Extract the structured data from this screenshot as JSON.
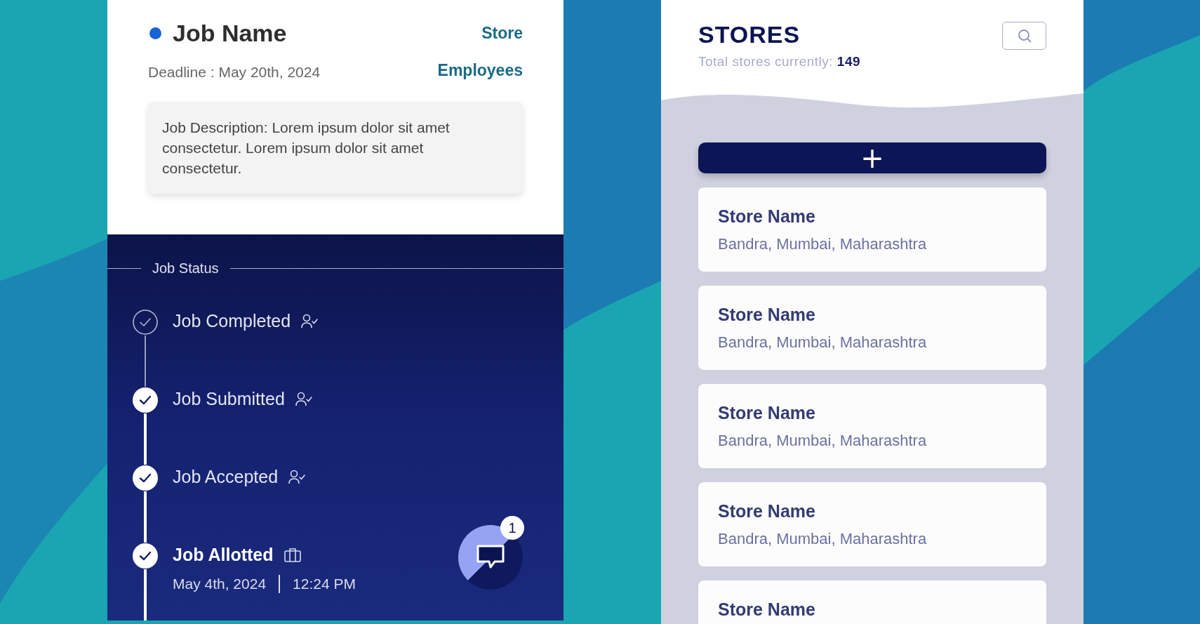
{
  "job": {
    "title": "Job Name",
    "deadline": "Deadline : May 20th, 2024",
    "links": [
      "Store",
      "Employees"
    ],
    "description": "Job Description: Lorem ipsum dolor sit amet consectetur. Lorem ipsum dolor sit amet consectetur."
  },
  "job_status": {
    "heading": "Job Status",
    "steps": [
      {
        "label": "Job Completed",
        "kind": "user",
        "done": false,
        "current": false
      },
      {
        "label": "Job Submitted",
        "kind": "user",
        "done": true,
        "current": false
      },
      {
        "label": "Job Accepted",
        "kind": "user",
        "done": true,
        "current": false
      },
      {
        "label": "Job Allotted",
        "kind": "work",
        "done": true,
        "current": true,
        "date": "May 4th, 2024",
        "time": "12:24 PM"
      }
    ]
  },
  "chat": {
    "badge": "1"
  },
  "stores": {
    "title": "STORES",
    "total": "Total stores currently: **149**",
    "add_button": "+",
    "items": [
      {
        "name": "Store Name",
        "address": "Bandra, Mumbai, Maharashtra"
      },
      {
        "name": "Store Name",
        "address": "Bandra, Mumbai, Maharashtra"
      },
      {
        "name": "Store Name",
        "address": "Bandra, Mumbai, Maharashtra"
      },
      {
        "name": "Store Name",
        "address": "Bandra, Mumbai, Maharashtra"
      },
      {
        "name": "Store Name"
      }
    ]
  }
}
